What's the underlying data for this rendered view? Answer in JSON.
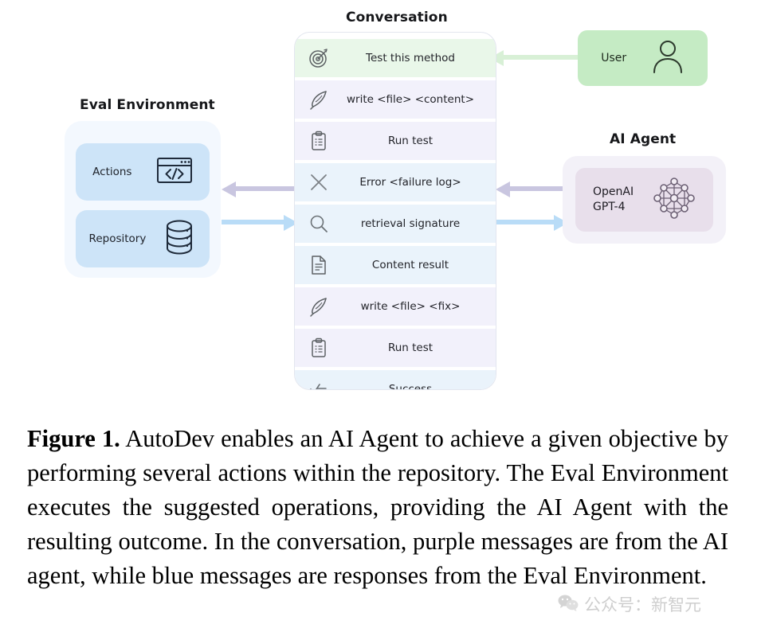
{
  "figure": {
    "conversation": {
      "title": "Conversation",
      "messages": [
        {
          "icon": "target-icon",
          "text": "Test this method",
          "tone": "green"
        },
        {
          "icon": "quill-icon",
          "text": "write <file> <content>",
          "tone": "purple"
        },
        {
          "icon": "clipboard-icon",
          "text": "Run test",
          "tone": "purple"
        },
        {
          "icon": "cross-icon",
          "text": "Error <failure log>",
          "tone": "blue"
        },
        {
          "icon": "magnifier-icon",
          "text": "retrieval signature",
          "tone": "blue"
        },
        {
          "icon": "document-icon",
          "text": "Content result",
          "tone": "blue"
        },
        {
          "icon": "quill-icon",
          "text": "write <file> <fix>",
          "tone": "purple"
        },
        {
          "icon": "clipboard-icon",
          "text": "Run test",
          "tone": "purple"
        },
        {
          "icon": "checklist-icon",
          "text": "Success",
          "tone": "blue"
        }
      ]
    },
    "eval_environment": {
      "title": "Eval Environment",
      "cards": [
        {
          "label": "Actions",
          "icon": "code-window-icon"
        },
        {
          "label": "Repository",
          "icon": "database-icon"
        }
      ]
    },
    "user": {
      "label": "User",
      "icon": "person-icon"
    },
    "ai_agent": {
      "title": "AI Agent",
      "card": {
        "label": "OpenAI\nGPT-4",
        "icon": "neural-network-icon"
      }
    },
    "arrows": [
      {
        "name": "user-to-conversation-arrow",
        "direction": "left",
        "color": "#d8f0d6"
      },
      {
        "name": "conversation-to-eval-arrow",
        "direction": "left",
        "color": "#c9c6e0"
      },
      {
        "name": "eval-to-conversation-arrow",
        "direction": "right",
        "color": "#b9dcf7"
      },
      {
        "name": "agent-to-conversation-arrow",
        "direction": "left",
        "color": "#c9c6e0"
      },
      {
        "name": "conversation-to-agent-arrow",
        "direction": "right",
        "color": "#b9dcf7"
      }
    ],
    "colors": {
      "green_message": "#e9f7e9",
      "purple_message": "#f2f1fb",
      "blue_message": "#eaf3fb",
      "eval_card": "#cde4f8",
      "eval_panel": "#f3f8fe",
      "user_box": "#c5ebc4",
      "agent_card": "#e8dfeb",
      "agent_panel": "#f3f1f8"
    }
  },
  "caption": {
    "label": "Figure 1.",
    "text": " AutoDev enables an AI Agent to achieve a given objective by performing several actions within the repository. The Eval Environment executes the suggested operations, providing the AI Agent with the resulting outcome. In the conversation, purple messages are from the AI agent, while blue messages are responses from the Eval Environment."
  },
  "watermark": {
    "text": "公众号：新智元",
    "icon": "wechat-logo-icon"
  }
}
